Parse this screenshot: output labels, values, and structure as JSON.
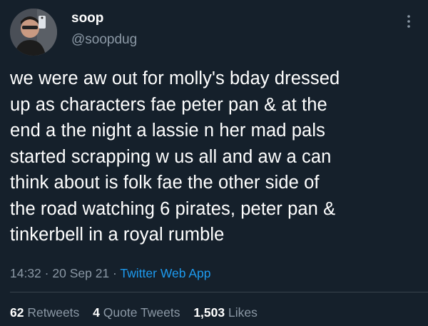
{
  "user": {
    "display_name": "soop",
    "handle": "@soopdug"
  },
  "tweet": {
    "text": "we were aw out for molly's bday dressed\nup as characters fae peter pan & at the\nend a the night a lassie n her mad pals\nstarted scrapping w us all and aw a can\nthink about is folk fae the other side of\nthe road watching 6 pirates, peter pan &\ntinkerbell in a royal rumble",
    "time": "14:32",
    "date": "20 Sep 21",
    "separator": "·",
    "source": "Twitter Web App"
  },
  "stats": {
    "retweets_count": "62",
    "retweets_label": "Retweets",
    "quotes_count": "4",
    "quotes_label": "Quote Tweets",
    "likes_count": "1,503",
    "likes_label": "Likes"
  },
  "icons": {
    "more": "more-options-icon"
  },
  "colors": {
    "background": "#15202b",
    "text": "#ffffff",
    "secondary_text": "#8b98a5",
    "link": "#1d9bf0",
    "divider": "#38444d"
  }
}
